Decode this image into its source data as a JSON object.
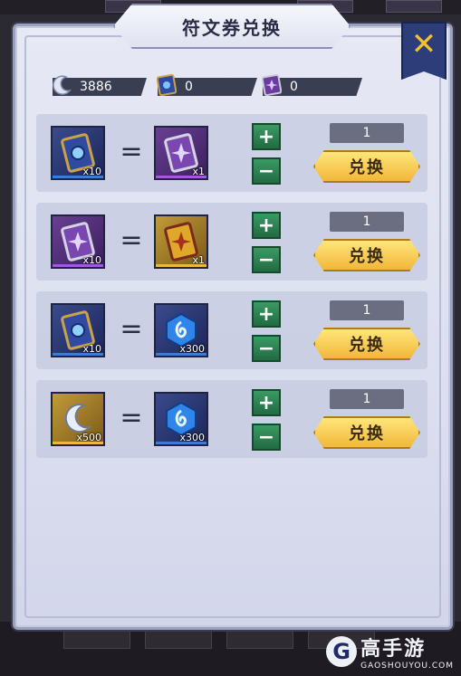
{
  "dialog": {
    "title": "符文券兑换"
  },
  "close": {
    "icon": "close-x-icon"
  },
  "currencies": [
    {
      "icon": "moon-crystal-icon",
      "value": "3886"
    },
    {
      "icon": "blue-rune-ticket-icon",
      "value": "0"
    },
    {
      "icon": "purple-rune-ticket-icon",
      "value": "0"
    }
  ],
  "rows": [
    {
      "from": {
        "icon": "blue-rune-ticket-icon",
        "qty": "x10"
      },
      "to": {
        "icon": "purple-rune-ticket-icon",
        "qty": "x1"
      },
      "count": "1",
      "button": "兑换"
    },
    {
      "from": {
        "icon": "purple-rune-ticket-icon",
        "qty": "x10"
      },
      "to": {
        "icon": "gold-rune-ticket-icon",
        "qty": "x1"
      },
      "count": "1",
      "button": "兑换"
    },
    {
      "from": {
        "icon": "blue-rune-ticket-icon",
        "qty": "x10"
      },
      "to": {
        "icon": "blue-gem-icon",
        "qty": "x300"
      },
      "count": "1",
      "button": "兑换"
    },
    {
      "from": {
        "icon": "moon-crystal-icon",
        "qty": "x500"
      },
      "to": {
        "icon": "blue-gem-icon",
        "qty": "x300"
      },
      "count": "1",
      "button": "兑换"
    }
  ],
  "equals_sign": "=",
  "plus_label": "+",
  "minus_label": "−",
  "watermark": {
    "logo": "G",
    "title": "高手游",
    "url": "GAOSHOUYOU.COM"
  }
}
